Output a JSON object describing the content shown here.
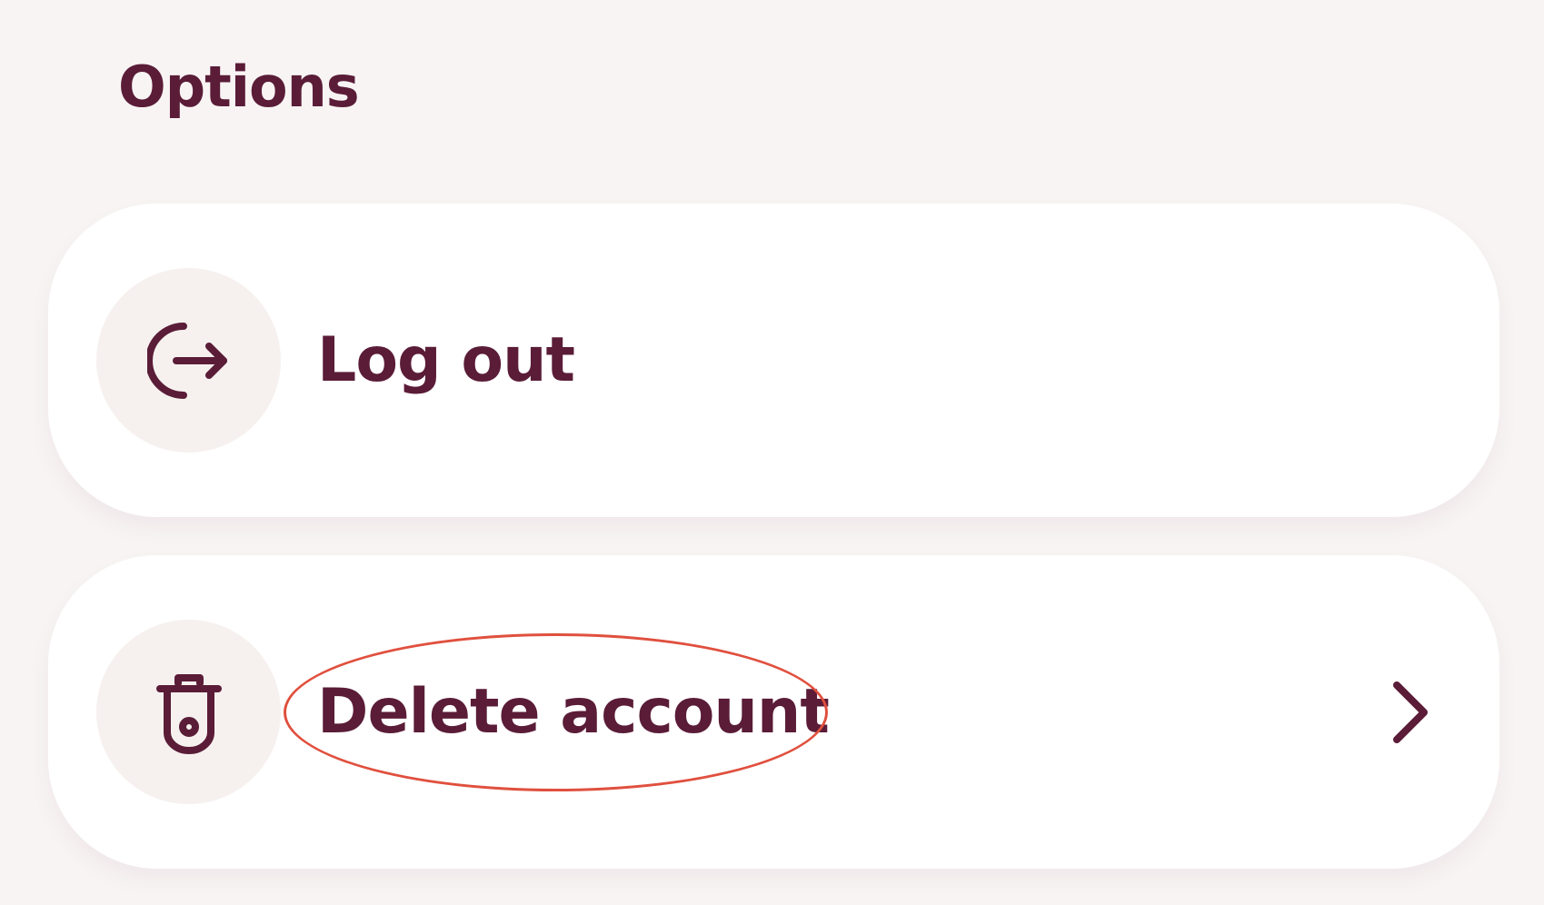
{
  "options": {
    "title": "Options",
    "items": [
      {
        "label": "Log out",
        "icon": "log-out-icon"
      },
      {
        "label": "Delete account",
        "icon": "trash-icon",
        "has_chevron": true
      }
    ]
  },
  "colors": {
    "background": "#f8f4f4",
    "card": "#ffffff",
    "icon_circle": "#f6f1ef",
    "text": "#5a1c37",
    "annotation": "#e0503e"
  }
}
